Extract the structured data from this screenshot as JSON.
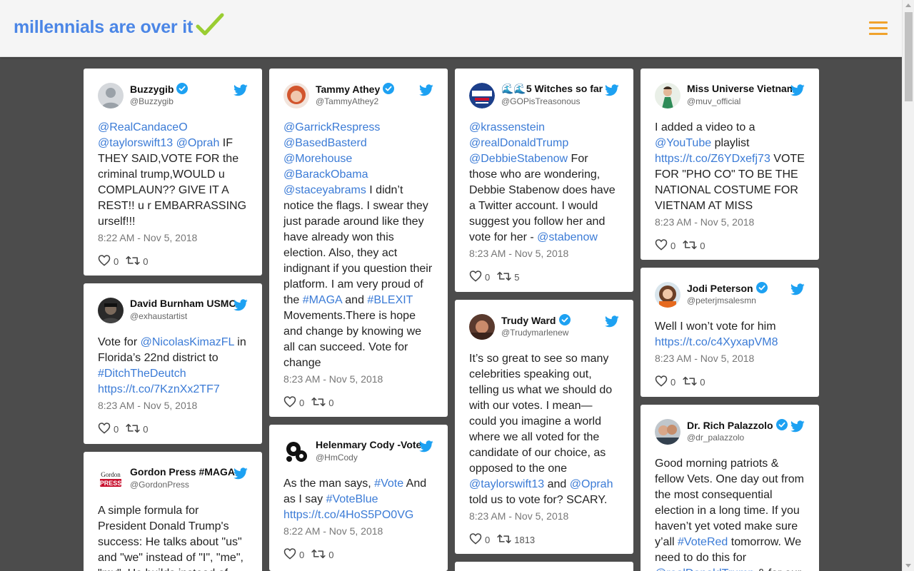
{
  "brand": {
    "title": "millennials are over it",
    "check_color": "#9acd32",
    "accent": "#4b86e6"
  },
  "menu": {
    "icon": "hamburger-icon",
    "color": "#f0a22c"
  },
  "cards": [
    {
      "name": "Buzzygib",
      "handle": "@Buzzygib",
      "verified": true,
      "avatar": "default-avatar",
      "text": [
        [
          "m",
          "@RealCandaceO"
        ],
        [
          "t",
          " "
        ],
        [
          "m",
          "@taylorswift13"
        ],
        [
          "t",
          " "
        ],
        [
          "m",
          "@Oprah"
        ],
        [
          "t",
          " IF THEY SAID,VOTE FOR the criminal trump,WOULD u COMPLAUN?? GIVE IT A REST!! u r EMBARRASSING urself!!!"
        ]
      ],
      "date": "8:22 AM - Nov 5, 2018",
      "likes": "0",
      "retweets": "0"
    },
    {
      "name": "David Burnham USMC",
      "handle": "@exhaustartist",
      "verified": false,
      "avatar": "photo-dark",
      "text": [
        [
          "t",
          "Vote for "
        ],
        [
          "m",
          "@NicolasKimazFL"
        ],
        [
          "t",
          " in Florida’s 22nd district to "
        ],
        [
          "m",
          "#DitchTheDeutch"
        ],
        [
          "t",
          " "
        ],
        [
          "m",
          "https://t.co/7KznXx2TF7"
        ]
      ],
      "date": "8:23 AM - Nov 5, 2018",
      "likes": "0",
      "retweets": "0"
    },
    {
      "name": "Gordon Press #MAGA",
      "handle": "@GordonPress",
      "verified": false,
      "avatar": "gordon-press-logo",
      "text": [
        [
          "t",
          "A simple formula for President Donald Trump's success: He talks about \"us\" and \"we\" instead of \"I\", \"me\", \"my\". He builds instead of"
        ]
      ],
      "date": "",
      "likes": "",
      "retweets": ""
    },
    {
      "name": "Tammy Athey",
      "handle": "@TammyAthey2",
      "verified": true,
      "avatar": "photo-redhair",
      "text": [
        [
          "m",
          "@GarrickRespress"
        ],
        [
          "t",
          " "
        ],
        [
          "m",
          "@BasedBasterd"
        ],
        [
          "t",
          " "
        ],
        [
          "m",
          "@Morehouse"
        ],
        [
          "t",
          " "
        ],
        [
          "m",
          "@BarackObama"
        ],
        [
          "t",
          " "
        ],
        [
          "m",
          "@staceyabrams"
        ],
        [
          "t",
          " I didn’t notice the flags. I swear they just parade around like they have already won this election. Also, they act indignant if you question their platform. I am very proud of the "
        ],
        [
          "m",
          "#MAGA"
        ],
        [
          "t",
          " and "
        ],
        [
          "m",
          "#BLEXIT"
        ],
        [
          "t",
          " Movements.There is hope and change by knowing we all can succeed. Vote for change"
        ]
      ],
      "date": "8:23 AM - Nov 5, 2018",
      "likes": "0",
      "retweets": "0"
    },
    {
      "name": "Helenmary Cody -Vote",
      "handle": "@HmCody",
      "verified": false,
      "avatar": "yin-yang-icon",
      "text": [
        [
          "t",
          "As the man says, "
        ],
        [
          "m",
          "#Vote"
        ],
        [
          "t",
          " And as I say "
        ],
        [
          "m",
          "#VoteBlue"
        ],
        [
          "t",
          " "
        ],
        [
          "m",
          "https://t.co/4HoS5PO0VG"
        ]
      ],
      "date": "8:22 AM - Nov 5, 2018",
      "likes": "0",
      "retweets": "0"
    },
    {
      "name": "🌊🌊5 Witches so far",
      "handle": "@GOPisTreasonous",
      "verified": false,
      "avatar": "trump-2020-badge",
      "text": [
        [
          "m",
          "@krassenstein"
        ],
        [
          "t",
          " "
        ],
        [
          "m",
          "@realDonaldTrump"
        ],
        [
          "t",
          " "
        ],
        [
          "m",
          "@DebbieStabenow"
        ],
        [
          "t",
          " For those who are wondering, Debbie Stabenow does have a Twitter account. I would suggest you follow her and vote for her - "
        ],
        [
          "m",
          "@stabenow"
        ]
      ],
      "date": "8:23 AM - Nov 5, 2018",
      "likes": "0",
      "retweets": "5"
    },
    {
      "name": "Trudy Ward",
      "handle": "@Trudymarlenew",
      "verified": true,
      "avatar": "photo-warm",
      "text": [
        [
          "t",
          "It’s so great to see so many celebrities speaking out, telling us what we should do with our votes. I mean—could you imagine a world where we all voted for the candidate of our choice, as opposed to the one "
        ],
        [
          "m",
          "@taylorswift13"
        ],
        [
          "t",
          " and "
        ],
        [
          "m",
          "@Oprah"
        ],
        [
          "t",
          " told us to vote for? SCARY."
        ]
      ],
      "date": "8:23 AM - Nov 5, 2018",
      "likes": "0",
      "retweets": "1813"
    },
    {
      "name": "Miss Universe Vietnam",
      "handle": "@muv_official",
      "verified": false,
      "avatar": "photo-pageant",
      "text": [
        [
          "t",
          "I added a video to a "
        ],
        [
          "m",
          "@YouTube"
        ],
        [
          "t",
          " playlist "
        ],
        [
          "m",
          "https://t.co/Z6YDxefj73"
        ],
        [
          "t",
          " VOTE FOR \"PHO CO\" TO BE THE NATIONAL COSTUME FOR VIETNAM AT MISS"
        ]
      ],
      "date": "8:23 AM - Nov 5, 2018",
      "likes": "0",
      "retweets": "0"
    },
    {
      "name": "Jodi Peterson",
      "handle": "@peterjmsalesmn",
      "verified": true,
      "avatar": "photo-brunette",
      "text": [
        [
          "t",
          "Well I won’t vote for him "
        ],
        [
          "m",
          "https://t.co/c4XyxapVM8"
        ]
      ],
      "date": "8:23 AM - Nov 5, 2018",
      "likes": "0",
      "retweets": "0"
    },
    {
      "name": "Dr. Rich Palazzolo",
      "handle": "@dr_palazzolo",
      "verified": true,
      "avatar": "photo-couple",
      "text": [
        [
          "t",
          "Good morning patriots & fellow Vets. One day out from the most consequential election in a long time. If you haven’t yet voted make sure y’all "
        ],
        [
          "m",
          "#VoteRed"
        ],
        [
          "t",
          " tomorrow. We need to do this for "
        ],
        [
          "m",
          "@realDonaldTrump"
        ],
        [
          "t",
          " & for our"
        ]
      ],
      "date": "",
      "likes": "",
      "retweets": ""
    }
  ],
  "colors": {
    "link": "#3b7bd6",
    "twitter_bird": "#1da1f2",
    "background": "#4c4c4c"
  }
}
